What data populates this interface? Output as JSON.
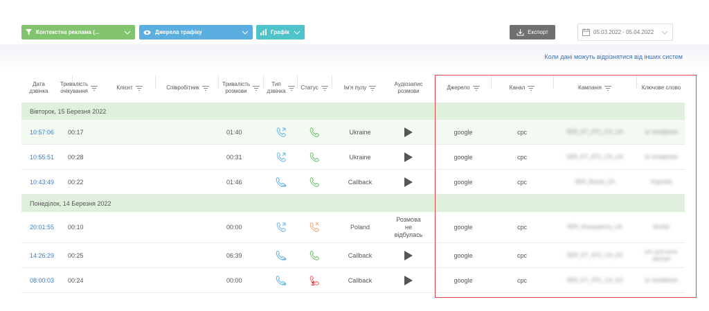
{
  "filters": {
    "context_ads": "Контекстна реклама (...",
    "traffic_sources": "Джерела трафіку",
    "chart": "Графік"
  },
  "toolbar": {
    "export_label": "Експорт",
    "date_range": "05.03.2022 - 05.04.2022"
  },
  "notice": "Коли дані можуть відрізнятися від інших систем",
  "columns": [
    {
      "label": "Дата\nдзвінка"
    },
    {
      "label": "Тривалість\nочікування"
    },
    {
      "label": "Клієнт"
    },
    {
      "label": "Співробітник"
    },
    {
      "label": "Тривалість\nрозмови"
    },
    {
      "label": "Тип\nдзвінка"
    },
    {
      "label": "Статус"
    },
    {
      "label": "Ім'я пулу"
    },
    {
      "label": "Аудіозапис\nрозмови"
    },
    {
      "label": "Джерело"
    },
    {
      "label": "Канал"
    },
    {
      "label": "Кампанія"
    },
    {
      "label": "Ключове слово"
    }
  ],
  "groups": [
    {
      "label": "Вівторок, 15 Березня 2022"
    },
    {
      "label": "Понеділок, 14 Березня 2022"
    }
  ],
  "rows": [
    {
      "time": "10:57:06",
      "wait": "00:17",
      "duration": "01:40",
      "type": "incoming-call-icon",
      "status": "answered-call-icon",
      "pool": "Ukraine",
      "audio": "play",
      "source": "google",
      "channel": "cpc",
      "campaign": "SER_KT_ATC_CA_UA",
      "keyword": "ip телефонія"
    },
    {
      "time": "10:55:51",
      "wait": "00:28",
      "duration": "00:31",
      "type": "incoming-call-icon",
      "status": "answered-call-icon",
      "pool": "Ukraine",
      "audio": "play",
      "source": "google",
      "channel": "cpc",
      "campaign": "SER_KT_ATC_CA_UA",
      "keyword": "ip телефонія"
    },
    {
      "time": "10:43:49",
      "wait": "00:22",
      "duration": "01:46",
      "type": "callback-call-icon",
      "status": "answered-call-icon",
      "pool": "Callback",
      "audio": "play",
      "source": "google",
      "channel": "cpc",
      "campaign": "SER_Brand_UA",
      "keyword": "ringostat"
    },
    {
      "time": "20:01:55",
      "wait": "00:10",
      "duration": "00:00",
      "type": "incoming-call-icon",
      "status": "missed-call-icon",
      "pool": "Poland",
      "audio_message": "Розмова\nне\nвідбулась",
      "source": "google",
      "channel": "cpc",
      "campaign": "SER_Конкуренты_UA",
      "keyword": "binotel"
    },
    {
      "time": "14:26:29",
      "wait": "00:25",
      "duration": "06:39",
      "type": "callback-call-icon",
      "status": "answered-call-icon",
      "pool": "Callback",
      "audio": "play",
      "source": "google",
      "channel": "cpc",
      "campaign": "SER_KT_ATC_CA_KZ",
      "keyword": "атс для колл\nцентра"
    },
    {
      "time": "08:00:03",
      "wait": "00:24",
      "duration": "00:00",
      "type": "callback-call-icon",
      "status": "employee-missed-icon",
      "pool": "Callback",
      "audio": "play",
      "source": "google",
      "channel": "cpc",
      "campaign": "SER_KT_ATC_CA_KZ",
      "keyword": "ip телефонія"
    }
  ],
  "colors": {
    "green_filter": "#82c46e",
    "blue_filter": "#5aaee0",
    "teal_filter": "#4ec3c9",
    "group_bg": "#dff0dc",
    "link": "#3a7dc4",
    "highlight_border": "#e0484d"
  }
}
